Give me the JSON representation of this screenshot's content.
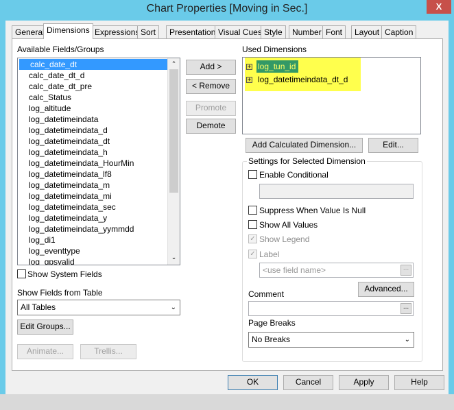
{
  "window": {
    "title": "Chart Properties [Moving in Sec.]",
    "close": "X"
  },
  "tabs": [
    "General",
    "Dimensions",
    "Expressions",
    "Sort",
    "Presentation",
    "Visual Cues",
    "Style",
    "Number",
    "Font",
    "Layout",
    "Caption"
  ],
  "available": {
    "label": "Available Fields/Groups",
    "items": [
      "calc_date_dt",
      "calc_date_dt_d",
      "calc_date_dt_pre",
      "calc_Status",
      "log_altitude",
      "log_datetimeindata",
      "log_datetimeindata_d",
      "log_datetimeindata_dt",
      "log_datetimeindata_h",
      "log_datetimeindata_HourMin",
      "log_datetimeindata_lf8",
      "log_datetimeindata_m",
      "log_datetimeindata_mi",
      "log_datetimeindata_sec",
      "log_datetimeindata_y",
      "log_datetimeindata_yymmdd",
      "log_di1",
      "log_eventtype",
      "log_gpsvalid"
    ]
  },
  "mid_buttons": {
    "add": "Add >",
    "remove": "< Remove",
    "promote": "Promote",
    "demote": "Demote"
  },
  "used": {
    "label": "Used Dimensions",
    "items": [
      "log_tun_id",
      "log_datetimeindata_dt_d"
    ],
    "highlight": "#ffff4d",
    "selected_bg": "#339966"
  },
  "add_calc": "Add Calculated Dimension...",
  "edit": "Edit...",
  "settings": {
    "title": "Settings for Selected Dimension",
    "enable_conditional": "Enable Conditional",
    "suppress": "Suppress When Value Is Null",
    "show_all": "Show All Values",
    "show_legend": "Show Legend",
    "label": "Label",
    "label_placeholder": "<use field name>",
    "advanced": "Advanced...",
    "comment": "Comment",
    "page_breaks": "Page Breaks",
    "page_breaks_value": "No Breaks",
    "dots": "..."
  },
  "left_bottom": {
    "show_system": "Show System Fields",
    "show_from_table": "Show Fields from Table",
    "table_value": "All Tables",
    "edit_groups": "Edit Groups...",
    "animate": "Animate...",
    "trellis": "Trellis..."
  },
  "footer": {
    "ok": "OK",
    "cancel": "Cancel",
    "apply": "Apply",
    "help": "Help"
  }
}
